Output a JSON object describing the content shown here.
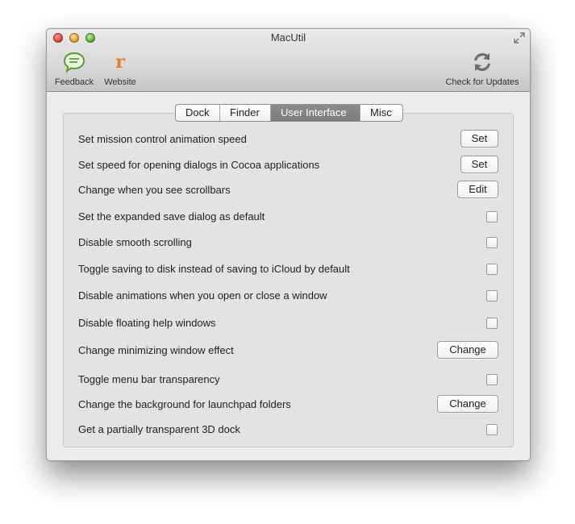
{
  "window": {
    "title": "MacUtil"
  },
  "toolbar": {
    "feedback_label": "Feedback",
    "website_label": "Website",
    "website_icon_char": "r",
    "update_label": "Check for Updates"
  },
  "tabs": [
    {
      "label": "Dock",
      "selected": false
    },
    {
      "label": "Finder",
      "selected": false
    },
    {
      "label": "User Interface",
      "selected": true
    },
    {
      "label": "Misc",
      "selected": false
    }
  ],
  "settings": [
    {
      "label": "Set mission control animation speed",
      "control": "button",
      "button_label": "Set"
    },
    {
      "label": "Set speed for opening dialogs in Cocoa applications",
      "control": "button",
      "button_label": "Set"
    },
    {
      "label": "Change when you see scrollbars",
      "control": "button",
      "button_label": "Edit"
    },
    {
      "label": "Set the expanded save dialog as default",
      "control": "checkbox",
      "checked": false
    },
    {
      "label": "Disable smooth scrolling",
      "control": "checkbox",
      "checked": false
    },
    {
      "label": "Toggle saving to disk instead of saving to iCloud by default",
      "control": "checkbox",
      "checked": false
    },
    {
      "label": "Disable animations when you open or close a window",
      "control": "checkbox",
      "checked": false
    },
    {
      "label": "Disable floating help windows",
      "control": "checkbox",
      "checked": false
    },
    {
      "label": "Change minimizing window effect",
      "control": "button",
      "button_label": "Change"
    },
    {
      "label": "Toggle menu bar transparency",
      "control": "checkbox",
      "checked": false
    },
    {
      "label": "Change the background for launchpad folders",
      "control": "button",
      "button_label": "Change"
    },
    {
      "label": "Get a partially transparent 3D dock",
      "control": "checkbox",
      "checked": false
    }
  ],
  "colors": {
    "feedback_icon": "#5a9e2f",
    "website_icon": "#e8801c",
    "update_icon": "#6e6e6e",
    "tab_active_bg": "#7f7f7f"
  }
}
